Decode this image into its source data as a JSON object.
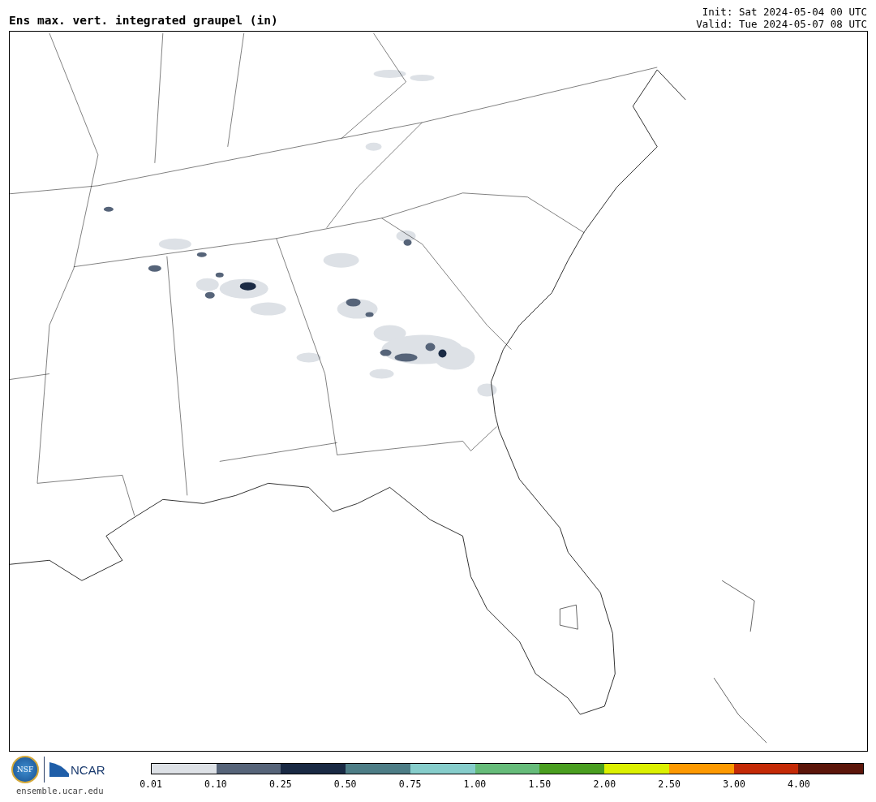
{
  "title": "Ens max. vert. integrated graupel (in)",
  "init": "Init: Sat 2024-05-04 00 UTC",
  "valid": "Valid: Tue 2024-05-07 08 UTC",
  "logos": {
    "nsf": "NSF",
    "ncar": "NCAR",
    "url": "ensemble.ucar.edu"
  },
  "colorbar": {
    "bins": [
      {
        "color": "#dde1e6",
        "label": "0.01"
      },
      {
        "color": "#566479",
        "label": "0.10"
      },
      {
        "color": "#1a2a44",
        "label": "0.25"
      },
      {
        "color": "#4d7d86",
        "label": "0.50"
      },
      {
        "color": "#86cdcb",
        "label": "0.75"
      },
      {
        "color": "#66bc7a",
        "label": "1.00"
      },
      {
        "color": "#4a9e20",
        "label": "1.50"
      },
      {
        "color": "#dcf000",
        "label": "2.00"
      },
      {
        "color": "#fd9900",
        "label": "2.50"
      },
      {
        "color": "#c42a06",
        "label": "3.00"
      },
      {
        "color": "#5c160a",
        "label": "4.00"
      }
    ]
  }
}
